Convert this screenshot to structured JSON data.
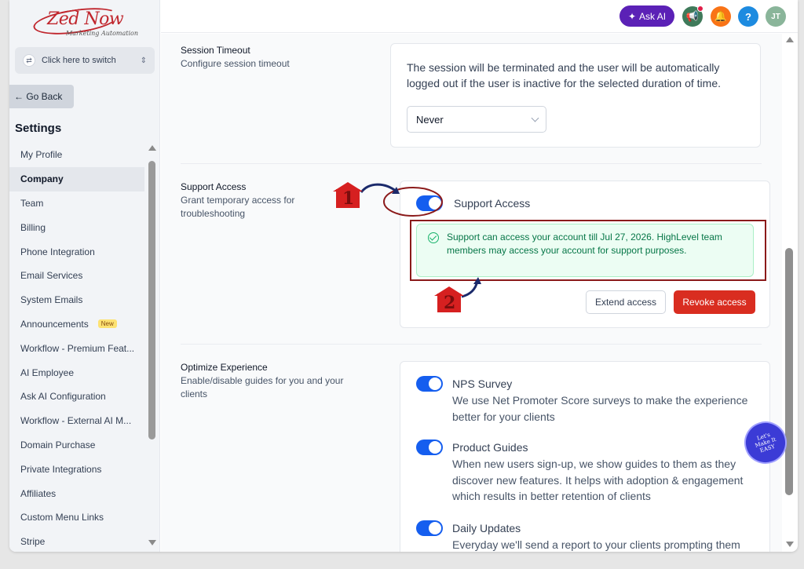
{
  "logo": {
    "name": "Zed Now",
    "tagline": "Marketing Automation"
  },
  "switcher": {
    "label": "Click here to switch"
  },
  "goback": {
    "label": "← Go Back"
  },
  "settings_title": "Settings",
  "nav": {
    "items": [
      {
        "label": "My Profile"
      },
      {
        "label": "Company",
        "active": true
      },
      {
        "label": "Team"
      },
      {
        "label": "Billing"
      },
      {
        "label": "Phone Integration"
      },
      {
        "label": "Email Services"
      },
      {
        "label": "System Emails"
      },
      {
        "label": "Announcements",
        "badge": "New"
      },
      {
        "label": "Workflow - Premium Feat..."
      },
      {
        "label": "AI Employee"
      },
      {
        "label": "Ask AI Configuration"
      },
      {
        "label": "Workflow - External AI M..."
      },
      {
        "label": "Domain Purchase"
      },
      {
        "label": "Private Integrations"
      },
      {
        "label": "Affiliates"
      },
      {
        "label": "Custom Menu Links"
      },
      {
        "label": "Stripe"
      }
    ]
  },
  "header": {
    "ask_ai": "Ask AI",
    "avatar_initials": "JT",
    "help": "?"
  },
  "session_timeout": {
    "title": "Session Timeout",
    "desc": "Configure session timeout",
    "text": "The session will be terminated and the user will be automatically logged out if the user is inactive for the selected duration of time.",
    "selected": "Never"
  },
  "support_access": {
    "title": "Support Access",
    "desc": "Grant temporary access for troubleshooting",
    "toggle_label": "Support Access",
    "toggle_on": true,
    "alert": "Support can access your account till Jul 27, 2026. HighLevel team members may access your account for support purposes.",
    "extend": "Extend access",
    "revoke": "Revoke access"
  },
  "optimize": {
    "title": "Optimize Experience",
    "desc": "Enable/disable guides for you and your clients",
    "options": [
      {
        "title": "NPS Survey",
        "desc": "We use Net Promoter Score surveys to make the experience better for your clients",
        "on": true
      },
      {
        "title": "Product Guides",
        "desc": "When new users sign-up, we show guides to them as they discover new features. It helps with adoption & engagement which results in better retention of clients",
        "on": true
      },
      {
        "title": "Daily Updates",
        "desc": "Everyday we'll send a report to your clients prompting them",
        "on": true
      }
    ]
  },
  "annotations": {
    "one": "1",
    "two": "2"
  },
  "watermark": "Let's Make It EASY",
  "colors": {
    "primary": "#155eef",
    "ask_ai": "#5b21b6",
    "revoke": "#d92d20",
    "success_bg": "#ecfdf3",
    "annotation": "#8b1a1a"
  }
}
